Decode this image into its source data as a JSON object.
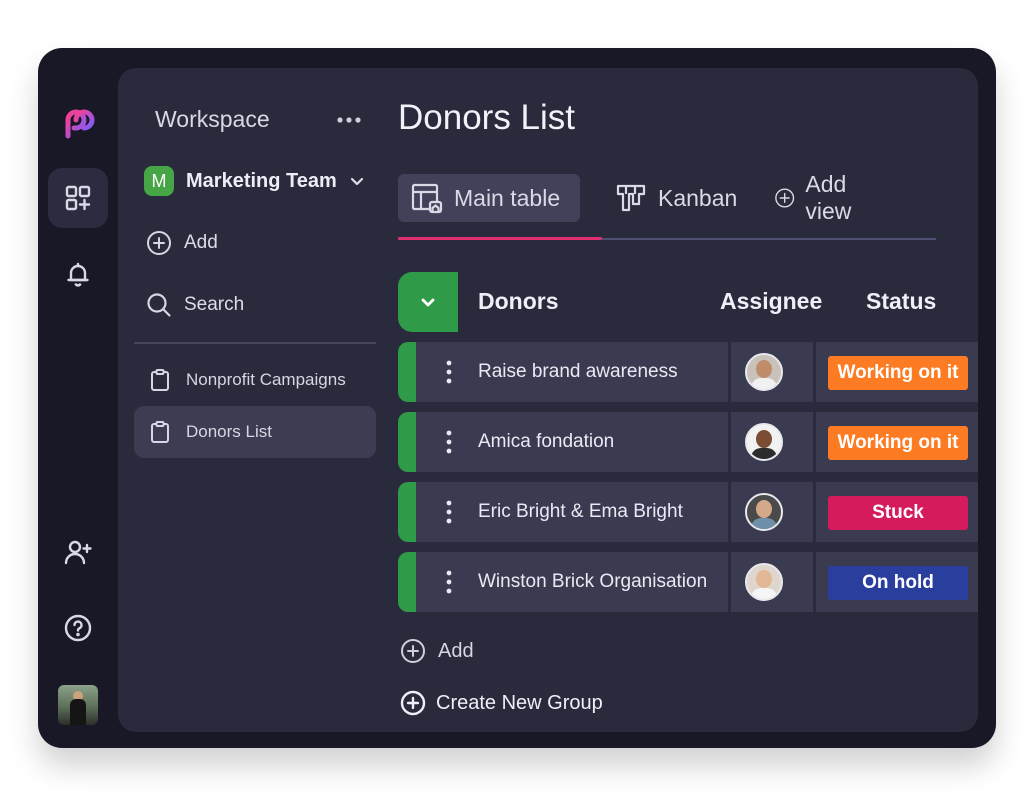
{
  "workspace": {
    "title": "Workspace",
    "team_initial": "M",
    "team_name": "Marketing Team",
    "add_label": "Add",
    "search_label": "Search",
    "boards": [
      {
        "label": "Nonprofit Campaigns",
        "active": false
      },
      {
        "label": "Donors List",
        "active": true
      }
    ]
  },
  "page": {
    "title": "Donors List"
  },
  "tabs": [
    {
      "label": "Main table",
      "icon": "table-icon",
      "active": true
    },
    {
      "label": "Kanban",
      "icon": "kanban-icon",
      "active": false
    },
    {
      "label": "Add view",
      "icon": "plus-circle-icon",
      "active": false
    }
  ],
  "group": {
    "name": "Donors",
    "columns": {
      "assignee": "Assignee",
      "status": "Status"
    },
    "rows": [
      {
        "name": "Raise brand awareness",
        "status": "Working on it",
        "status_color": "#fd7b22"
      },
      {
        "name": "Amica fondation",
        "status": "Working on it",
        "status_color": "#fd7b22"
      },
      {
        "name": "Eric Bright & Ema Bright",
        "status": "Stuck",
        "status_color": "#d61a5e"
      },
      {
        "name": "Winston Brick Organisation",
        "status": "On hold",
        "status_color": "#2a3e9e"
      }
    ]
  },
  "actions": {
    "add_item": "Add",
    "create_group": "Create New Group"
  },
  "colors": {
    "accent": "#e0306f",
    "group": "#2f9a47",
    "panel": "#2a2a3d",
    "frame": "#181826"
  }
}
